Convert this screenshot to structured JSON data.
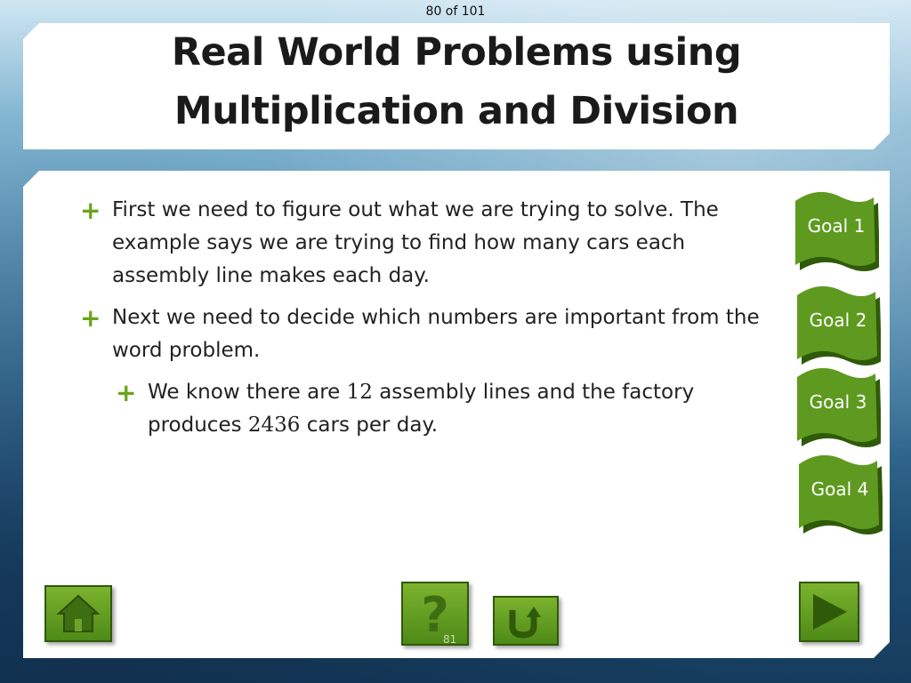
{
  "counter": "80 of 101",
  "title": {
    "line1": "Real World Problems using",
    "line2": "Multiplication and Division"
  },
  "bullets": [
    {
      "text": "First we need to figure out what we are trying to solve. The example says we are trying to find how many cars each assembly line makes each day."
    },
    {
      "text": "Next we need to decide which numbers are important from the word problem."
    },
    {
      "part1": "We know there are ",
      "num1": "12",
      "part2": " assembly lines and the factory produces ",
      "num2": "2436",
      "part3": " cars per day."
    }
  ],
  "goals": [
    "Goal 1",
    "Goal 2",
    "Goal 3",
    "Goal 4"
  ],
  "slide_number": "81",
  "icons": {
    "bullet": "plus-icon",
    "home": "home-icon",
    "help": "question-icon",
    "back": "return-arrow-icon",
    "next": "play-arrow-icon"
  },
  "colors": {
    "accent_green": "#6aa31c",
    "button_green": "#5e9a1f"
  }
}
